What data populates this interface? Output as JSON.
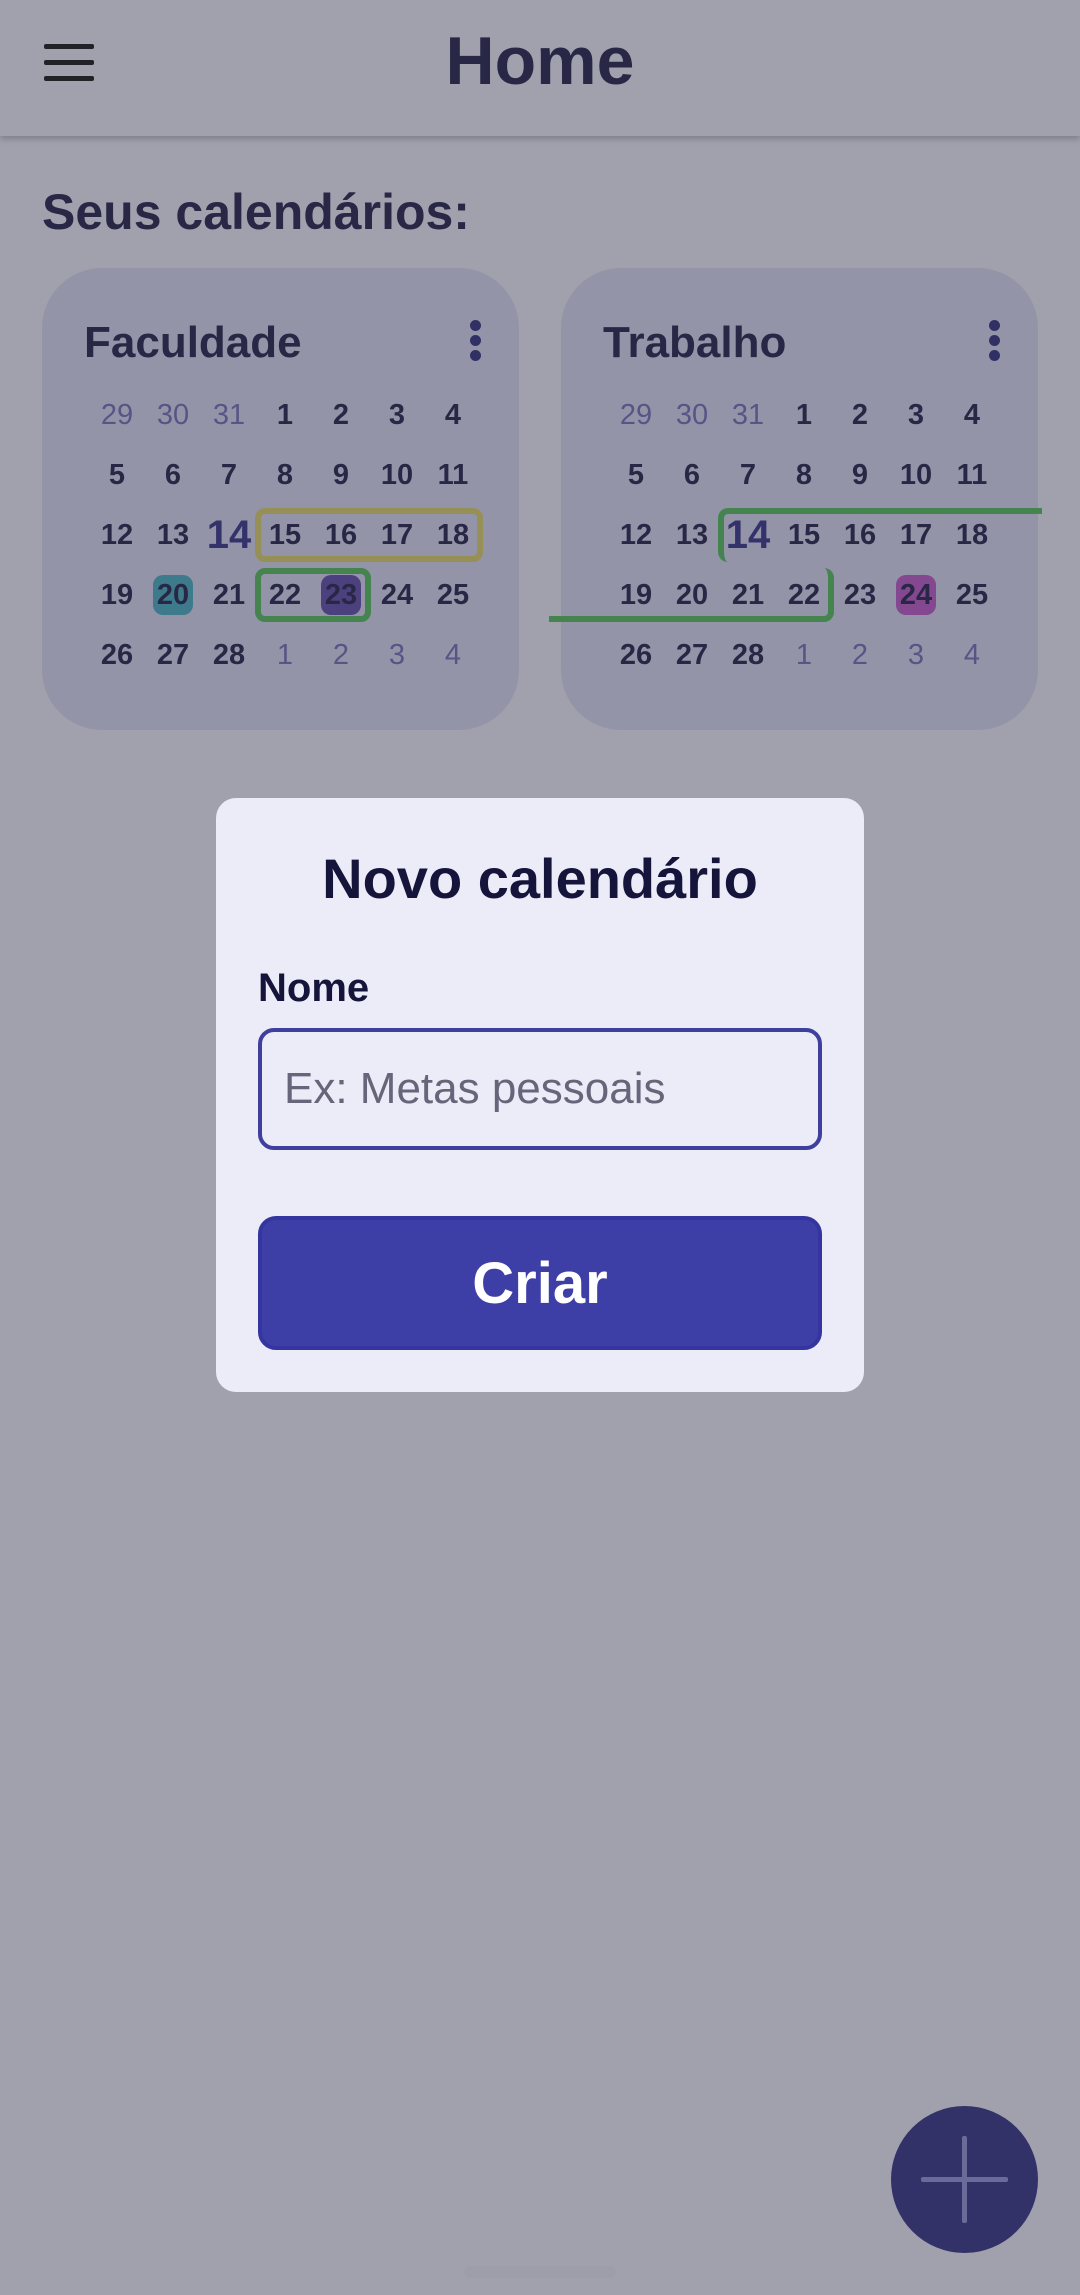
{
  "app_bar": {
    "title": "Home",
    "menu_icon": "hamburger-menu-icon"
  },
  "section_title": "Seus calendários:",
  "calendars": [
    {
      "name": "Faculdade",
      "today": "14",
      "weeks": [
        [
          "29",
          "30",
          "31",
          "1",
          "2",
          "3",
          "4"
        ],
        [
          "5",
          "6",
          "7",
          "8",
          "9",
          "10",
          "11"
        ],
        [
          "12",
          "13",
          "14",
          "15",
          "16",
          "17",
          "18"
        ],
        [
          "19",
          "20",
          "21",
          "22",
          "23",
          "24",
          "25"
        ],
        [
          "26",
          "27",
          "28",
          "1",
          "2",
          "3",
          "4"
        ]
      ],
      "muted_cells": [
        [
          0,
          0
        ],
        [
          0,
          1
        ],
        [
          0,
          2
        ],
        [
          4,
          3
        ],
        [
          4,
          4
        ],
        [
          4,
          5
        ],
        [
          4,
          6
        ]
      ],
      "highlights": [
        {
          "row": 3,
          "col": 1,
          "color": "#3fa9c0"
        },
        {
          "row": 3,
          "col": 4,
          "color": "#5a48a8"
        }
      ],
      "range_outlines": [
        {
          "row": 2,
          "from": 3,
          "to": 6,
          "color": "#d9cf62"
        },
        {
          "row": 3,
          "from": 3,
          "to": 4,
          "color": "#4fba57"
        }
      ]
    },
    {
      "name": "Trabalho",
      "today": "14",
      "weeks": [
        [
          "29",
          "30",
          "31",
          "1",
          "2",
          "3",
          "4"
        ],
        [
          "5",
          "6",
          "7",
          "8",
          "9",
          "10",
          "11"
        ],
        [
          "12",
          "13",
          "14",
          "15",
          "16",
          "17",
          "18"
        ],
        [
          "19",
          "20",
          "21",
          "22",
          "23",
          "24",
          "25"
        ],
        [
          "26",
          "27",
          "28",
          "1",
          "2",
          "3",
          "4"
        ]
      ],
      "muted_cells": [
        [
          0,
          0
        ],
        [
          0,
          1
        ],
        [
          0,
          2
        ],
        [
          4,
          3
        ],
        [
          4,
          4
        ],
        [
          4,
          5
        ],
        [
          4,
          6
        ]
      ],
      "highlights": [
        {
          "row": 3,
          "col": 5,
          "color": "#b854c4"
        }
      ],
      "range_outlines": [
        {
          "row": 2,
          "from": 2,
          "to": 6,
          "color": "#4fba57",
          "open_right": true
        },
        {
          "row": 3,
          "from": 0,
          "to": 3,
          "color": "#4fba57",
          "open_left": true
        }
      ]
    }
  ],
  "dialog": {
    "title": "Novo calendário",
    "field_label": "Nome",
    "name_value": "",
    "name_placeholder": "Ex: Metas pessoais",
    "create_label": "Criar"
  },
  "fab": {
    "icon": "plus-icon"
  },
  "colors": {
    "primary": "#3e3fa6",
    "card_bg": "#d6d6f0",
    "surface": "#ecebf8",
    "text": "#1c1b46"
  }
}
